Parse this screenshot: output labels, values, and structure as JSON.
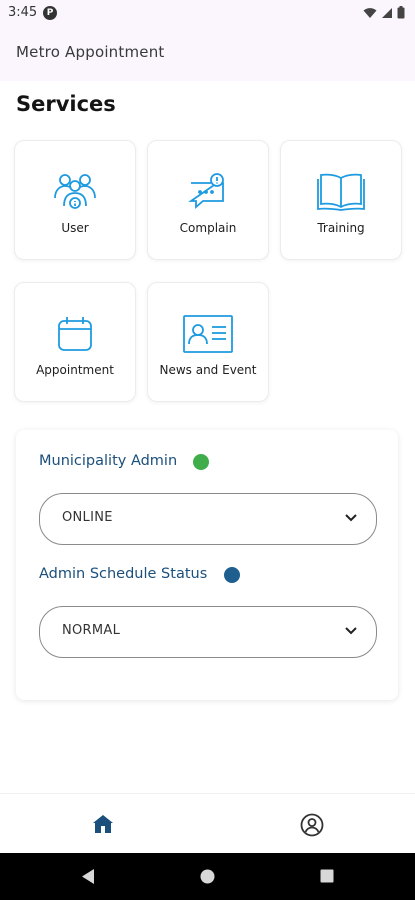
{
  "status_bar": {
    "time": "3:45",
    "notification_glyph": "P"
  },
  "app_bar": {
    "title": "Metro Appointment"
  },
  "services": {
    "title": "Services",
    "items": [
      {
        "label": "User",
        "icon": "users-icon"
      },
      {
        "label": "Complain",
        "icon": "complain-chat-icon"
      },
      {
        "label": "Training",
        "icon": "book-icon"
      },
      {
        "label": "Appointment",
        "icon": "calendar-icon"
      },
      {
        "label": "News and Event",
        "icon": "id-card-icon"
      }
    ]
  },
  "admin_panel": {
    "municipality_label": "Municipality Admin",
    "municipality_status_color": "#3fae4a",
    "municipality_value": "ONLINE",
    "schedule_label": "Admin Schedule Status",
    "schedule_status_color": "#1f5f8f",
    "schedule_value": "NORMAL"
  },
  "bottom_nav": {
    "items": [
      {
        "icon": "home-icon",
        "active": true
      },
      {
        "icon": "profile-icon",
        "active": false
      }
    ]
  },
  "colors": {
    "accent": "#1b4f7c",
    "icon_blue": "#1e9be0",
    "app_bar_bg": "#fbf6fd"
  }
}
